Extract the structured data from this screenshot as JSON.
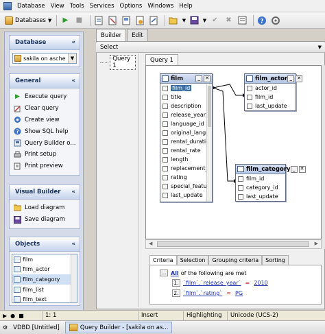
{
  "menu": [
    "Database",
    "View",
    "Tools",
    "Services",
    "Options",
    "Windows",
    "Help"
  ],
  "toolbar": {
    "databases_label": "Databases"
  },
  "left": {
    "database": {
      "title": "Database",
      "selected_db": "sakila on asche"
    },
    "general": {
      "title": "General",
      "items": [
        {
          "label": "Execute query",
          "icon": "play-icon"
        },
        {
          "label": "Clear query",
          "icon": "clear-icon"
        },
        {
          "label": "Create view",
          "icon": "view-icon"
        },
        {
          "label": "Show SQL help",
          "icon": "help-icon"
        },
        {
          "label": "Query Builder o...",
          "icon": "options-icon"
        },
        {
          "label": "Print setup",
          "icon": "print-setup-icon"
        },
        {
          "label": "Print preview",
          "icon": "print-preview-icon"
        }
      ]
    },
    "visual_builder": {
      "title": "Visual Builder",
      "items": [
        {
          "label": "Load diagram",
          "icon": "folder-open-icon"
        },
        {
          "label": "Save diagram",
          "icon": "save-icon"
        }
      ]
    },
    "objects": {
      "title": "Objects",
      "items": [
        "film",
        "film_actor",
        "film_category",
        "film_list",
        "film_text"
      ],
      "selected": "film_category"
    }
  },
  "tabs": {
    "builder": "Builder",
    "edit": "Edit"
  },
  "select_label": "Select",
  "query_tree_label": "Query 1",
  "query_tab_label": "Query 1",
  "tables": {
    "film": {
      "name": "film",
      "fields": [
        "film_id",
        "title",
        "description",
        "release_year",
        "language_id",
        "original_languag",
        "rental_duration",
        "rental_rate",
        "length",
        "replacement_co",
        "rating",
        "special_feature",
        "last_update"
      ]
    },
    "film_actor": {
      "name": "film_actor",
      "fields": [
        "actor_id",
        "film_id",
        "last_update"
      ]
    },
    "film_category": {
      "name": "film_category",
      "fields": [
        "film_id",
        "category_id",
        "last_update"
      ]
    }
  },
  "criteria": {
    "tabs": [
      "Criteria",
      "Selection",
      "Grouping criteria",
      "Sorting"
    ],
    "all_label": "All",
    "header_text": "of the following are met",
    "rows": [
      {
        "num": "1.",
        "field": "`film`.`release_year`",
        "op": "=",
        "value": "2010"
      },
      {
        "num": "2.",
        "field": "`film`.`rating`",
        "op": "=",
        "value": "PG"
      }
    ]
  },
  "status": {
    "position": "1:  1",
    "mode": "Insert",
    "highlighting": "Highlighting",
    "encoding": "Unicode (UCS-2)"
  },
  "taskbar": {
    "vdbd": "VDBD [Untitled]",
    "qb": "Query Builder - [sakila on as..."
  }
}
